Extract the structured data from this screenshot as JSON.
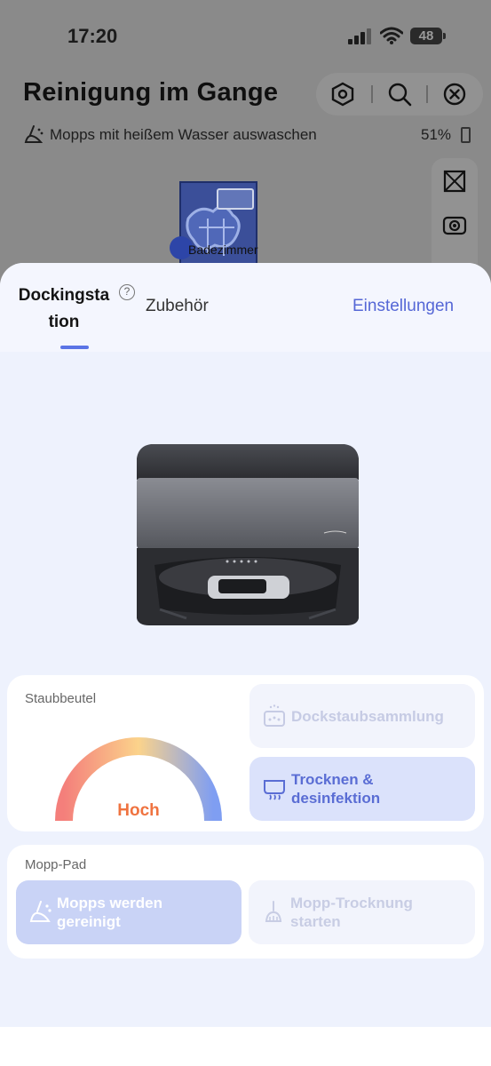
{
  "status_bar": {
    "time": "17:20",
    "battery": "48"
  },
  "background_app": {
    "title": "Reinigung im Gange",
    "subtitle": "Mopps mit heißem Wasser auswaschen",
    "battery_percent": "51%",
    "room_label": "Badezimmer",
    "toolbar_icons": [
      "hexagon-target-icon",
      "search-icon",
      "close-circle-icon"
    ],
    "side_icons": [
      "map-view-icon",
      "camera-icon",
      "more-icon"
    ]
  },
  "sheet": {
    "tabs": [
      {
        "label": "Dockingstation",
        "active": true
      },
      {
        "label": "Zubehör",
        "active": false
      }
    ],
    "dock_tab_line1": "Dockingsta",
    "dock_tab_line2": "tion",
    "help_glyph": "?",
    "settings_label": "Einstellungen",
    "dust_card": {
      "title": "Staubbeutel",
      "gauge_level": "Hoch",
      "gradient_colors": [
        "#f47f7b",
        "#fbd38b",
        "#7f9ef2"
      ]
    },
    "actions": {
      "dust_collection": {
        "label": "Dockstaubsammlung",
        "enabled": false,
        "icon": "dust-bin-icon"
      },
      "dry_disinfect": {
        "label_line1": "Trocknen &",
        "label_line2": "desinfektion",
        "enabled": true,
        "icon": "dry-disinfect-icon"
      }
    },
    "mop_card": {
      "title": "Mopp-Pad",
      "wash": {
        "label_line1": "Mopps werden",
        "label_line2": "gereinigt",
        "active": true,
        "icon": "mop-wash-icon"
      },
      "mop_dry": {
        "label_line1": "Mopp-Trocknung",
        "label_line2": "starten",
        "enabled": false,
        "icon": "mop-dry-icon"
      }
    }
  },
  "colors": {
    "accent": "#5b74e6",
    "settings_link": "#5567d6",
    "gauge_text": "#ef7340",
    "sheet_bg": "#eef2fd"
  }
}
